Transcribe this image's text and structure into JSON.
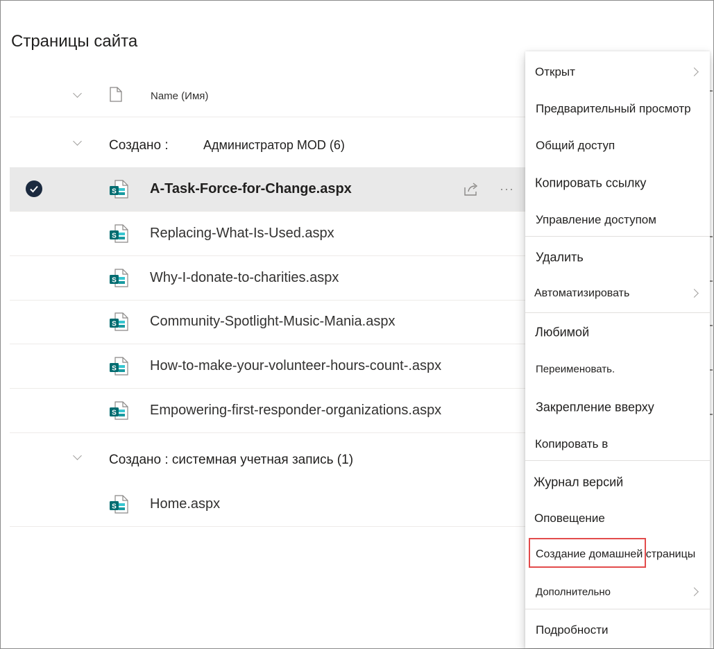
{
  "page": {
    "title": "Страницы сайта"
  },
  "columns": {
    "name_label": "Name (Имя)",
    "file_icon": "document-icon"
  },
  "groups": [
    {
      "label": "Создано :",
      "value": "Администратор MOD (6)"
    },
    {
      "label": "Создано : системная учетная запись (1)"
    }
  ],
  "files": [
    {
      "name": "A-Task-Force-for-Change.aspx",
      "selected": true,
      "icon": "sharepoint-page-icon"
    },
    {
      "name": "Replacing-What-Is-Used.aspx",
      "icon": "sharepoint-page-icon"
    },
    {
      "name": "Why-I-donate-to-charities.aspx",
      "icon": "sharepoint-page-icon"
    },
    {
      "name": "Community-Spotlight-Music-Mania.aspx",
      "icon": "sharepoint-page-icon"
    },
    {
      "name": "How-to-make-your-volunteer-hours-count-.aspx",
      "icon": "sharepoint-page-icon"
    },
    {
      "name": "Empowering-first-responder-organizations.aspx",
      "icon": "sharepoint-page-icon"
    },
    {
      "name": "Home.aspx",
      "icon": "sharepoint-page-icon"
    }
  ],
  "row_actions": {
    "share_icon": "share-icon",
    "more_icon": "more-icon"
  },
  "context_menu": {
    "items": [
      {
        "label": "Открыт",
        "submenu": true
      },
      {
        "label": "Предварительный просмотр"
      },
      {
        "label": "Общий доступ"
      },
      {
        "label": "Копировать ссылку"
      },
      {
        "label": "Управление доступом"
      },
      {
        "label": "Удалить"
      },
      {
        "label": "Автоматизировать",
        "submenu": true
      },
      {
        "label": "Любимой"
      },
      {
        "label": "Переименовать."
      },
      {
        "label": "Закрепление вверху"
      },
      {
        "label": "Копировать в"
      },
      {
        "label": "Журнал версий"
      },
      {
        "label": "Оповещение"
      },
      {
        "label": "Создание домашней страницы",
        "highlighted": true
      },
      {
        "label": "Дополнительно",
        "submenu": true
      },
      {
        "label": "Подробности"
      }
    ]
  },
  "colors": {
    "highlight_border": "#e24b4b",
    "selected_row": "#e9e9e9",
    "sharepoint_teal": "#036c70",
    "check_bg": "#1b2a3f"
  }
}
